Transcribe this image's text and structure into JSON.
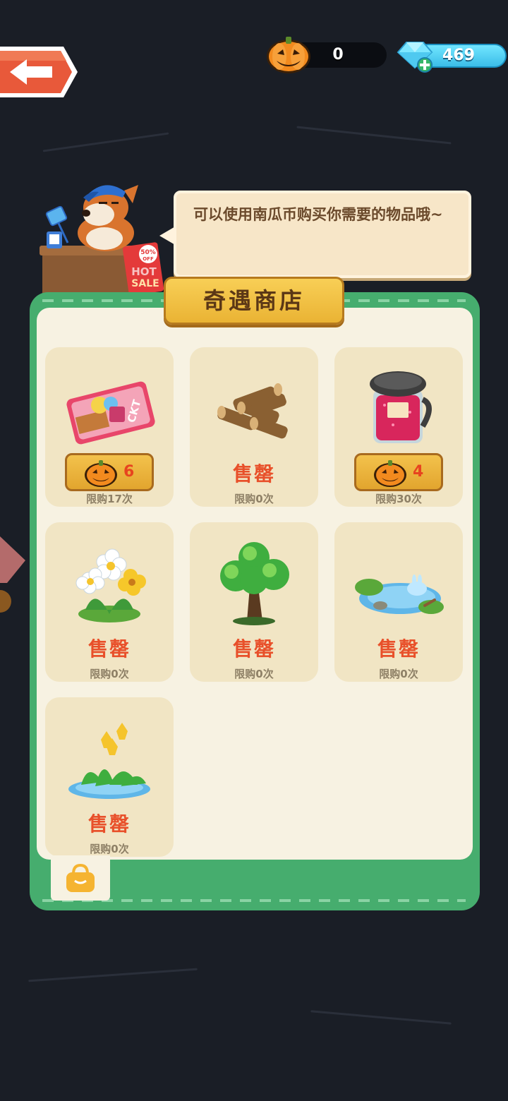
{
  "header": {
    "pumpkin_count": "0",
    "gem_count": "469"
  },
  "npc": {
    "speech": "可以使用南瓜币购买你需要的物品哦~",
    "sign_top": "50%",
    "sign_off": "OFF",
    "sign_hot": "HOT",
    "sign_sale": "SALE"
  },
  "shop": {
    "title": "奇遇商店",
    "items": [
      {
        "art": "ticket",
        "price": "6",
        "status": "",
        "limit": "限购17次"
      },
      {
        "art": "wood-logs",
        "price": "",
        "status": "售罄",
        "limit": "限购0次"
      },
      {
        "art": "jam-jar",
        "price": "4",
        "status": "",
        "limit": "限购30次"
      },
      {
        "art": "flowers",
        "price": "",
        "status": "售罄",
        "limit": "限购0次"
      },
      {
        "art": "tree",
        "price": "",
        "status": "售罄",
        "limit": "限购0次"
      },
      {
        "art": "pond",
        "price": "",
        "status": "售罄",
        "limit": "限购0次"
      },
      {
        "art": "water-flowers",
        "price": "",
        "status": "售罄",
        "limit": "限购0次"
      }
    ]
  },
  "colors": {
    "panel_green": "#46ad6e",
    "sold_out_red": "#e8502a",
    "gold": "#eab334"
  }
}
